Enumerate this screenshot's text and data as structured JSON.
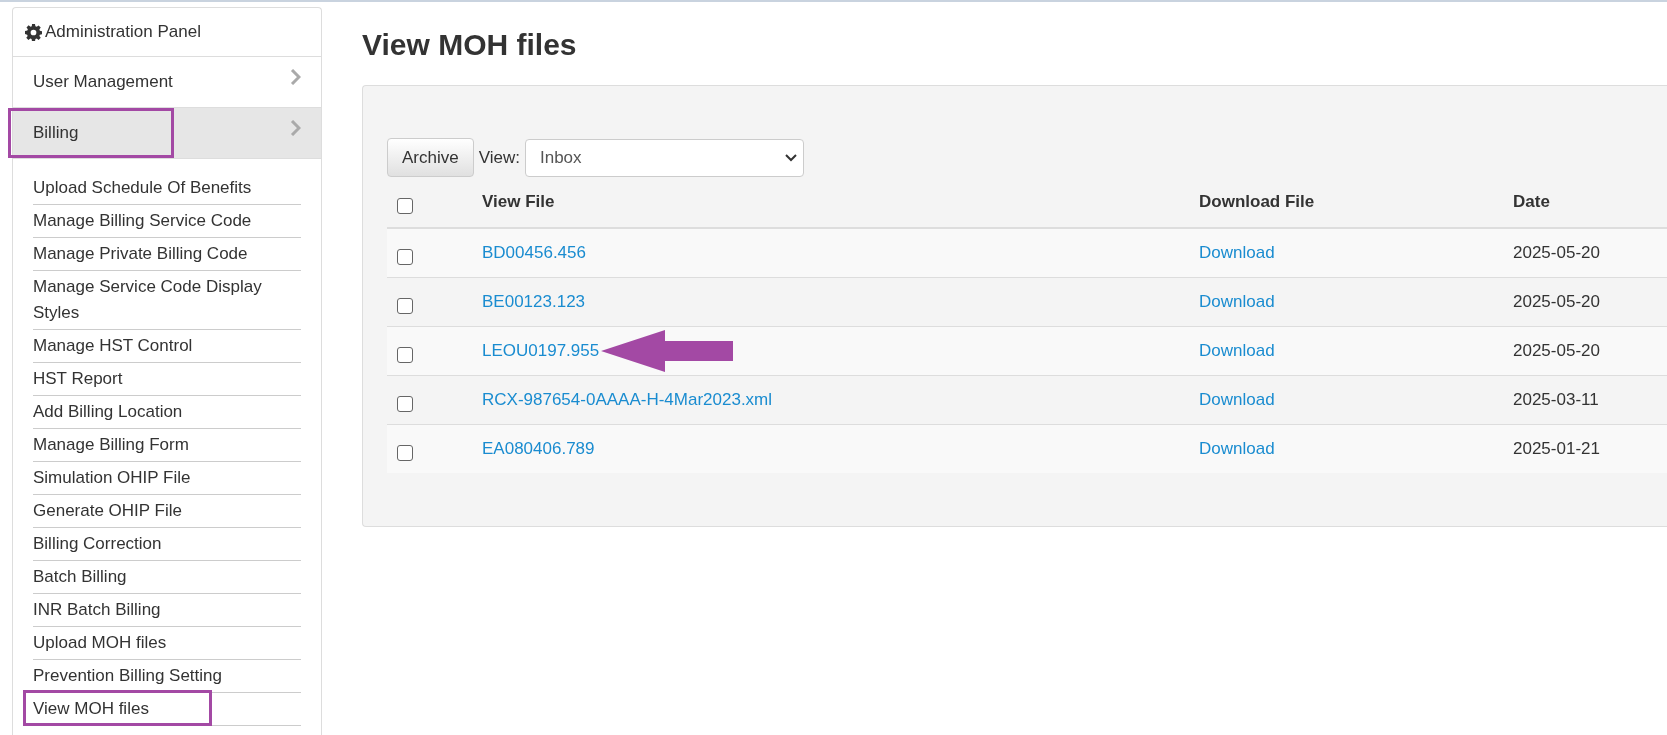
{
  "sidebar": {
    "title": "Administration Panel",
    "sections": [
      {
        "label": "User Management",
        "selected": false,
        "highlighted": false
      },
      {
        "label": "Billing",
        "selected": true,
        "highlighted": true
      }
    ],
    "items": [
      {
        "label": "Upload Schedule Of Benefits",
        "highlighted": false
      },
      {
        "label": "Manage Billing Service Code",
        "highlighted": false
      },
      {
        "label": "Manage Private Billing Code",
        "highlighted": false
      },
      {
        "label": "Manage Service Code Display Styles",
        "highlighted": false
      },
      {
        "label": "Manage HST Control",
        "highlighted": false
      },
      {
        "label": "HST Report",
        "highlighted": false
      },
      {
        "label": "Add Billing Location",
        "highlighted": false
      },
      {
        "label": "Manage Billing Form",
        "highlighted": false
      },
      {
        "label": "Simulation OHIP File",
        "highlighted": false
      },
      {
        "label": "Generate OHIP File",
        "highlighted": false
      },
      {
        "label": "Billing Correction",
        "highlighted": false
      },
      {
        "label": "Batch Billing",
        "highlighted": false
      },
      {
        "label": "INR Batch Billing",
        "highlighted": false
      },
      {
        "label": "Upload MOH files",
        "highlighted": false
      },
      {
        "label": "Prevention Billing Setting",
        "highlighted": false
      },
      {
        "label": "View MOH files",
        "highlighted": true
      }
    ]
  },
  "page_title": "View MOH files",
  "toolbar": {
    "archive_button": "Archive",
    "view_label": "View:",
    "view_value": "Inbox"
  },
  "table": {
    "select_all_checked": false,
    "columns": [
      "View File",
      "Download File",
      "Date"
    ],
    "rows": [
      {
        "checked": false,
        "file": "BD00456.456",
        "download": "Download",
        "date": "2025-05-20",
        "arrow": false
      },
      {
        "checked": false,
        "file": "BE00123.123",
        "download": "Download",
        "date": "2025-05-20",
        "arrow": false
      },
      {
        "checked": false,
        "file": "LEOU0197.955",
        "download": "Download",
        "date": "2025-05-20",
        "arrow": true
      },
      {
        "checked": false,
        "file": "RCX-987654-0AAAA-H-4Mar2023.xml",
        "download": "Download",
        "date": "2025-03-11",
        "arrow": false
      },
      {
        "checked": false,
        "file": "EA080406.789",
        "download": "Download",
        "date": "2025-01-21",
        "arrow": false
      }
    ]
  }
}
